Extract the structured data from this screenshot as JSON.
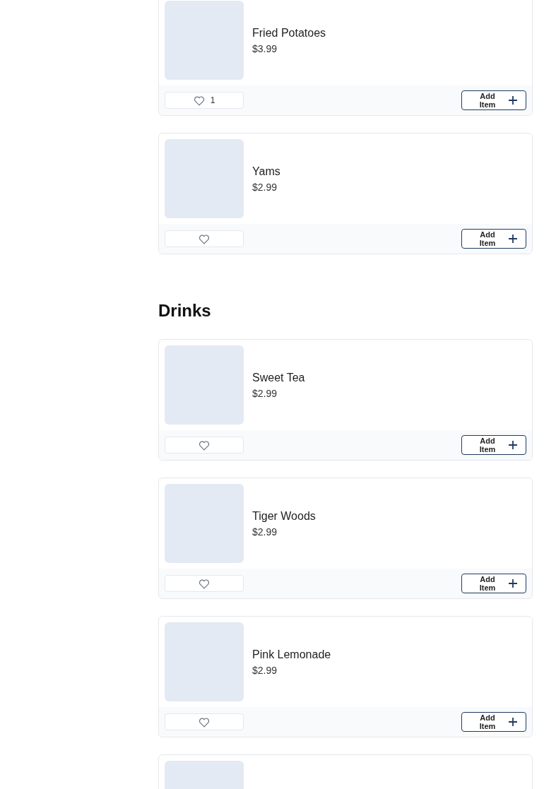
{
  "sections": [
    {
      "items": [
        {
          "kind": "product",
          "name": "Fried Potatoes",
          "price": "$3.99",
          "likes": "1",
          "add_label": "Add Item"
        },
        {
          "kind": "product",
          "name": "Yams",
          "price": "$2.99",
          "add_label": "Add Item"
        }
      ]
    },
    {
      "title": "Drinks",
      "items": [
        {
          "kind": "product",
          "name": "Sweet Tea",
          "price": "$2.99",
          "add_label": "Add Item"
        },
        {
          "kind": "product",
          "name": "Tiger Woods",
          "price": "$2.99",
          "add_label": "Add Item"
        },
        {
          "kind": "product",
          "name": "Pink Lemonade",
          "price": "$2.99",
          "add_label": "Add Item"
        },
        {
          "kind": "picture"
        }
      ]
    }
  ]
}
